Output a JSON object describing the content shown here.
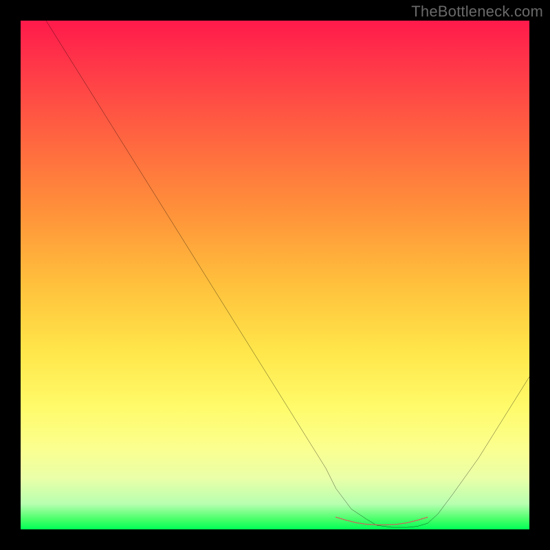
{
  "watermark": "TheBottleneck.com",
  "chart_data": {
    "type": "line",
    "title": "",
    "xlabel": "",
    "ylabel": "",
    "xlim": [
      0,
      100
    ],
    "ylim": [
      0,
      100
    ],
    "grid": false,
    "legend": false,
    "series": [
      {
        "name": "bottleneck-curve",
        "x": [
          5,
          10,
          15,
          20,
          25,
          30,
          35,
          40,
          45,
          50,
          55,
          60,
          62,
          65,
          68,
          70,
          73,
          76,
          78,
          80,
          82,
          85,
          90,
          95,
          100
        ],
        "y": [
          100,
          92,
          84,
          76,
          68,
          60,
          52,
          44,
          36,
          28,
          20,
          12,
          8,
          4,
          2,
          0.8,
          0.4,
          0.4,
          0.6,
          1.2,
          3,
          7,
          14,
          22,
          30
        ],
        "color": "#000000"
      },
      {
        "name": "optimal-zone-marker",
        "x": [
          62,
          64,
          66,
          68,
          70,
          72,
          74,
          76,
          78,
          80
        ],
        "y": [
          2.4,
          1.8,
          1.3,
          1.0,
          0.9,
          0.9,
          1.0,
          1.3,
          1.8,
          2.4
        ],
        "color": "#d85a5a"
      }
    ],
    "colors": {
      "gradient_top": "#ff1a4b",
      "gradient_bottom": "#00ff55",
      "curve": "#000000",
      "marker": "#d85a5a"
    }
  }
}
